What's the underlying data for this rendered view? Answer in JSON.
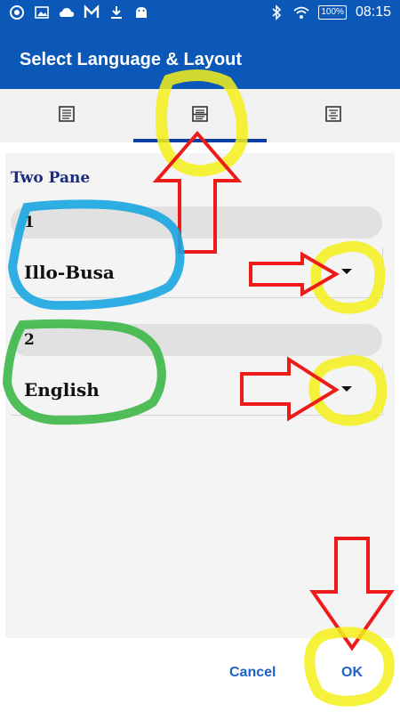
{
  "status_bar": {
    "left_icons": [
      "app-icon",
      "image-icon",
      "cloud-icon",
      "gmail-icon",
      "download-icon",
      "android-icon"
    ],
    "right_icons": [
      "bluetooth-icon",
      "wifi-icon"
    ],
    "battery": "100%",
    "time": "08:15"
  },
  "app_bar": {
    "title": "Select Language & Layout"
  },
  "tabs": [
    {
      "icon": "single-pane-layout-icon",
      "selected": false
    },
    {
      "icon": "two-pane-layout-icon",
      "selected": true
    },
    {
      "icon": "interlinear-layout-icon",
      "selected": false
    }
  ],
  "layout": {
    "section_title": "Two Pane",
    "panes": [
      {
        "number": "1",
        "language": "Illo-Busa"
      },
      {
        "number": "2",
        "language": "English"
      }
    ]
  },
  "actions": {
    "cancel": "Cancel",
    "ok": "OK"
  },
  "colors": {
    "primary": "#0c58b8",
    "accent_text": "#1b63c4",
    "section_title": "#1b2b7f"
  }
}
